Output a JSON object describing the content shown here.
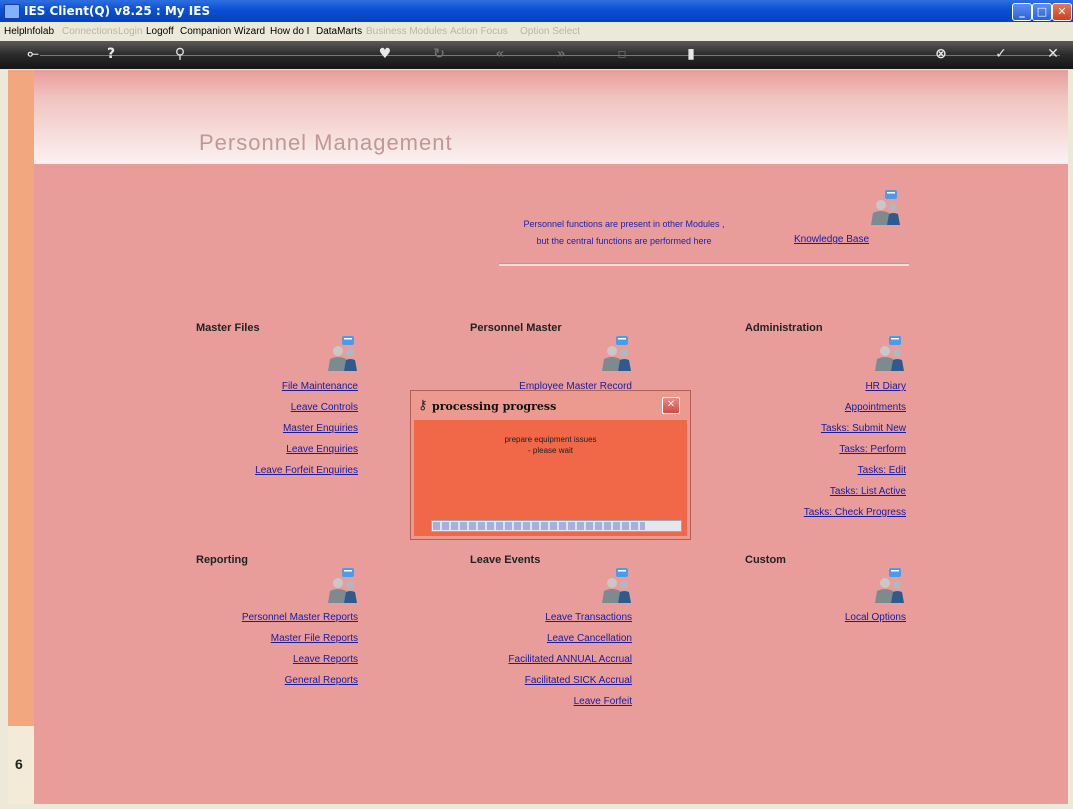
{
  "window": {
    "title": "IES Client(Q) v8.25 : My IES",
    "buttons": {
      "minimize": "_",
      "maximize": "□",
      "close": "✕"
    }
  },
  "menu": {
    "items": [
      {
        "label": "Help",
        "enabled": true
      },
      {
        "label": "Infolab",
        "enabled": true
      },
      {
        "label": "Connections",
        "enabled": false
      },
      {
        "label": "Login",
        "enabled": false
      },
      {
        "label": "Logoff",
        "enabled": true
      },
      {
        "label": "Companion",
        "enabled": true
      },
      {
        "label": "Wizard",
        "enabled": true
      },
      {
        "label": "How do I",
        "enabled": true
      },
      {
        "label": "DataMarts",
        "enabled": true
      },
      {
        "label": "Business Modules",
        "enabled": false
      },
      {
        "label": "Action Focus",
        "enabled": false
      },
      {
        "label": "Option Select",
        "enabled": false
      }
    ]
  },
  "toolbar": {
    "icons": [
      "back-arrow-icon",
      "help-icon",
      "search-icon",
      "heart-icon",
      "refresh-icon",
      "rewind-icon",
      "fast-forward-icon",
      "square-icon",
      "pause-icon",
      "close-circle-icon",
      "check-icon",
      "exit-icon"
    ]
  },
  "page": {
    "title": "Personnel Management",
    "intro_line1": "Personnel functions are present in other Modules ,",
    "intro_line2": "but the central functions are performed here",
    "knowledge_base": "Knowledge Base"
  },
  "sections": {
    "master_files": {
      "title": "Master Files",
      "links": [
        "File Maintenance",
        "Leave Controls",
        "Master Enquiries",
        "Leave Enquiries",
        "Leave Forfeit Enquiries"
      ]
    },
    "personnel_master": {
      "title": "Personnel Master",
      "links": [
        "Employee Master Record"
      ]
    },
    "administration": {
      "title": "Administration",
      "links": [
        "HR Diary",
        "Appointments",
        "Tasks: Submit New",
        "Tasks: Perform",
        "Tasks: Edit",
        "Tasks: List Active",
        "Tasks: Check Progress"
      ]
    },
    "reporting": {
      "title": "Reporting",
      "links": [
        "Personnel Master Reports",
        "Master File Reports",
        "Leave Reports",
        "General Reports"
      ]
    },
    "leave_events": {
      "title": "Leave Events",
      "links": [
        "Leave Transactions",
        "Leave Cancellation",
        "Facilitated ANNUAL Accrual",
        "Facilitated SICK Accrual",
        "Leave Forfeit"
      ]
    },
    "custom": {
      "title": "Custom",
      "links": [
        "Local Options"
      ]
    }
  },
  "dialog": {
    "title": "processing progress",
    "message_line1": "prepare equipment issues",
    "message_line2": "- please wait",
    "progress": 0.86
  },
  "side": {
    "label": "6"
  },
  "colors": {
    "page_bg": "#e89d9a",
    "link": "#1a1aa0",
    "dialog_body": "#f06848",
    "frame": "#f2a77e"
  }
}
